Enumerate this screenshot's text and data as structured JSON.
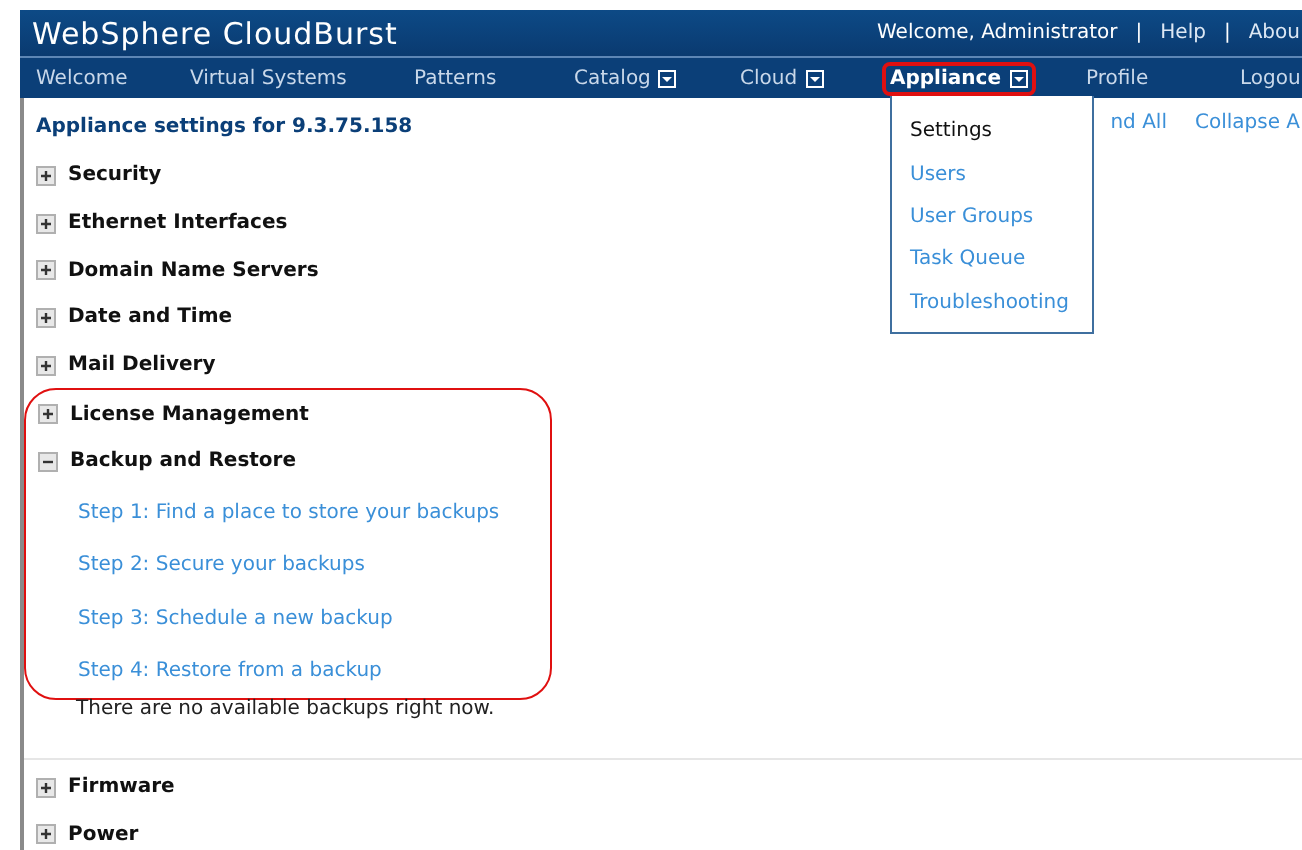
{
  "header": {
    "title": "WebSphere CloudBurst",
    "user_links": [
      {
        "label": "Welcome, Administrator",
        "kind": "text"
      },
      {
        "label": "|",
        "kind": "separator"
      },
      {
        "label": "Help",
        "kind": "link"
      },
      {
        "label": "|",
        "kind": "separator"
      },
      {
        "label": "Abou",
        "kind": "link"
      }
    ]
  },
  "nav": [
    {
      "label": "Welcome",
      "selected": false,
      "dropdown": false,
      "annotated": false
    },
    {
      "label": "Virtual Systems",
      "selected": false,
      "dropdown": false,
      "annotated": false
    },
    {
      "label": "Patterns",
      "selected": false,
      "dropdown": false,
      "annotated": false
    },
    {
      "label": "Catalog",
      "selected": false,
      "dropdown": true,
      "annotated": false
    },
    {
      "label": "Cloud",
      "selected": false,
      "dropdown": true,
      "annotated": false
    },
    {
      "label": "Appliance",
      "selected": true,
      "dropdown": true,
      "annotated": true
    },
    {
      "label": "Profile",
      "selected": false,
      "dropdown": false,
      "annotated": false
    },
    {
      "label": "Logou",
      "selected": false,
      "dropdown": false,
      "annotated": false
    }
  ],
  "menu": {
    "items": [
      {
        "label": "Settings",
        "selected": true
      },
      {
        "label": "Users",
        "selected": false
      },
      {
        "label": "User Groups",
        "selected": false
      },
      {
        "label": "Task Queue",
        "selected": false
      },
      {
        "label": "Troubleshooting",
        "selected": false
      }
    ]
  },
  "page": {
    "heading": "Appliance settings for 9.3.75.158",
    "actions": [
      "nd All",
      "Collapse A"
    ]
  },
  "sections": [
    {
      "label": "Security",
      "expanded": false,
      "annotated": false
    },
    {
      "label": "Ethernet Interfaces",
      "expanded": false,
      "annotated": false
    },
    {
      "label": "Domain Name Servers",
      "expanded": false,
      "annotated": false
    },
    {
      "label": "Date and Time",
      "expanded": false,
      "annotated": false
    },
    {
      "label": "Mail Delivery",
      "expanded": false,
      "annotated": false
    },
    {
      "label": "License Management",
      "expanded": false,
      "annotated": true
    },
    {
      "label": "Backup and Restore",
      "expanded": true,
      "annotated": true,
      "steps": [
        "Step 1: Find a place to store your backups",
        "Step 2: Secure your backups",
        "Step 3: Schedule a new backup",
        "Step 4: Restore from a backup"
      ],
      "note": "There are no available backups right now."
    },
    {
      "label": "Firmware",
      "expanded": false,
      "annotated": false
    },
    {
      "label": "Power",
      "expanded": false,
      "annotated": false
    }
  ]
}
